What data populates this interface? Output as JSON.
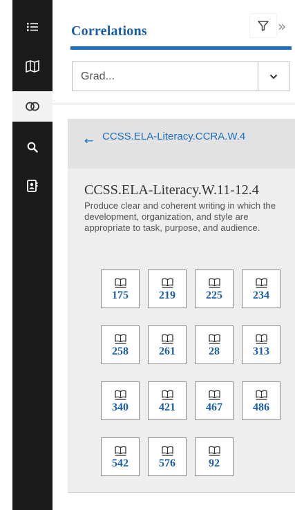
{
  "rail": {
    "items": [
      {
        "icon": "list-icon",
        "active": false
      },
      {
        "icon": "map-icon",
        "active": false
      },
      {
        "icon": "correlations-rings-icon",
        "active": true
      },
      {
        "icon": "search-icon",
        "active": false
      },
      {
        "icon": "contact-card-icon",
        "active": false
      }
    ]
  },
  "header": {
    "title": "Correlations",
    "filter_icon": "filter-icon",
    "expand_glyph": "»"
  },
  "grade_select": {
    "value": "Grad...",
    "caret_icon": "chevron-down-icon"
  },
  "back_link": {
    "arrow": "←",
    "label": "CCSS.ELA-Literacy.CCRA.W.4"
  },
  "standard": {
    "code": "CCSS.ELA-Literacy.W.11-12.4",
    "description": "Produce clear and coherent writing in which the development, organization, and style are appropriate to task, purpose, and audience."
  },
  "pages": [
    "175",
    "219",
    "225",
    "234",
    "258",
    "261",
    "28",
    "313",
    "340",
    "421",
    "467",
    "486",
    "542",
    "576",
    "92"
  ],
  "colors": {
    "accent": "#1a6fc0",
    "rail_bg": "#1b1b1b",
    "content_bg": "#eeeeee"
  }
}
